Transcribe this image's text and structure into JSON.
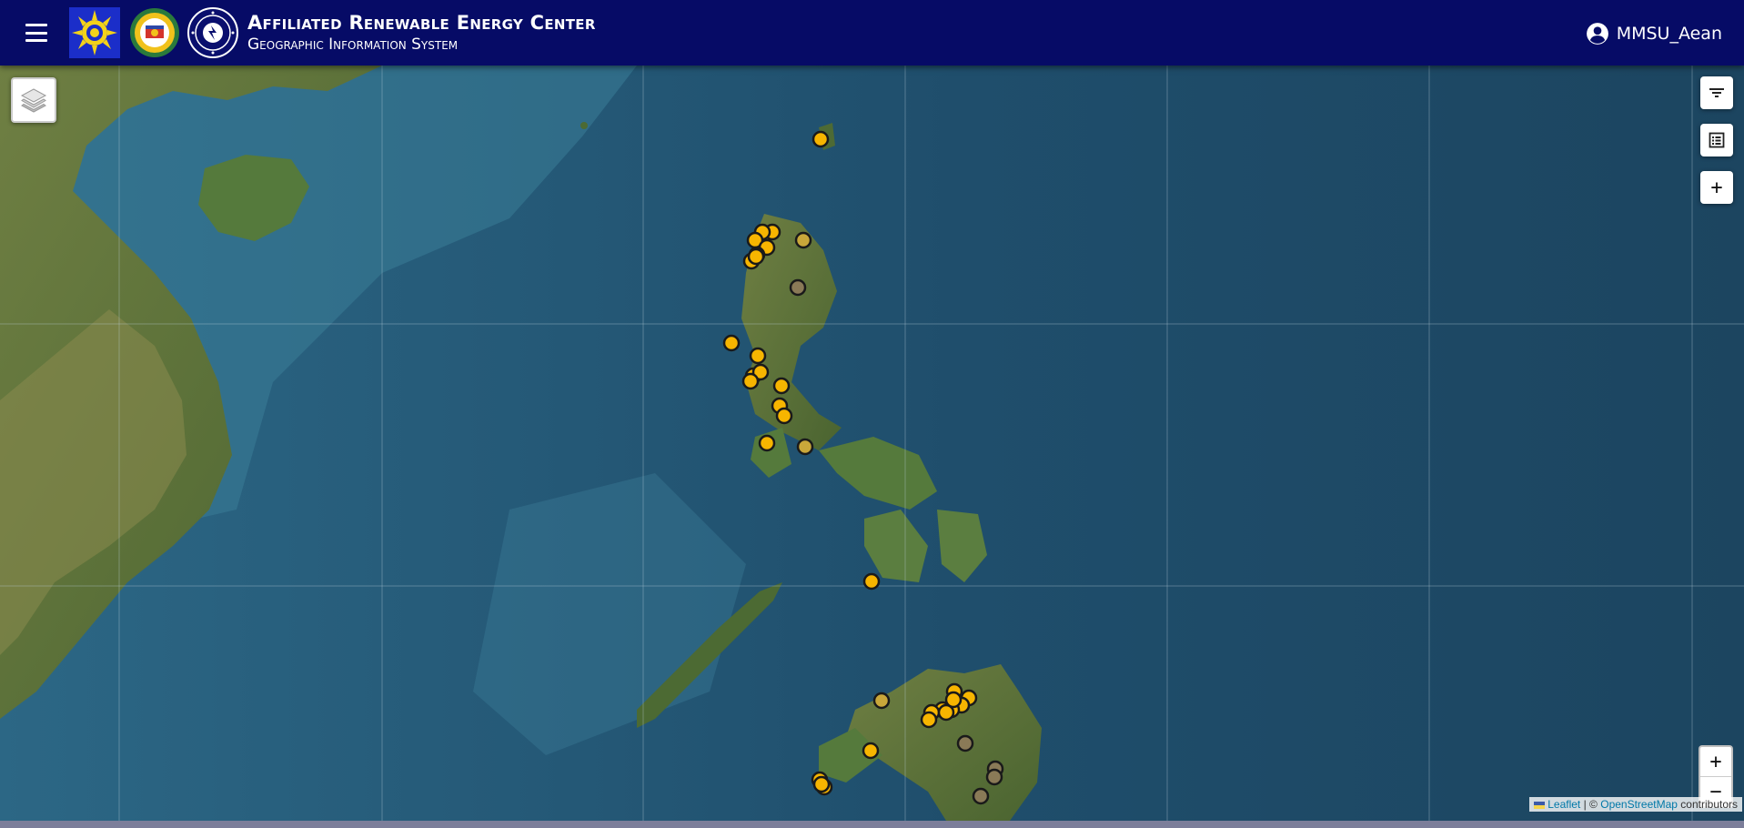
{
  "header": {
    "title": "Affiliated Renewable Energy Center",
    "subtitle": "Geographic Information System",
    "user": "MMSU_Aean",
    "bg_color": "#060b66",
    "logos": [
      "sunburst-gear-logo",
      "mmsu-seal-logo",
      "energy-seal-logo"
    ]
  },
  "map": {
    "marker_color_primary": "#f7b500",
    "marker_color_secondary": "#8a7a57",
    "controls": {
      "layers_icon": "layers-icon",
      "filter_icon": "filter-icon",
      "list_icon": "list-icon",
      "add_label": "+",
      "zoom_in": "+",
      "zoom_out": "−"
    },
    "attribution": {
      "leaflet": "Leaflet",
      "separator": "| ©",
      "osm": "OpenStreetMap",
      "contributors": "contributors"
    }
  }
}
